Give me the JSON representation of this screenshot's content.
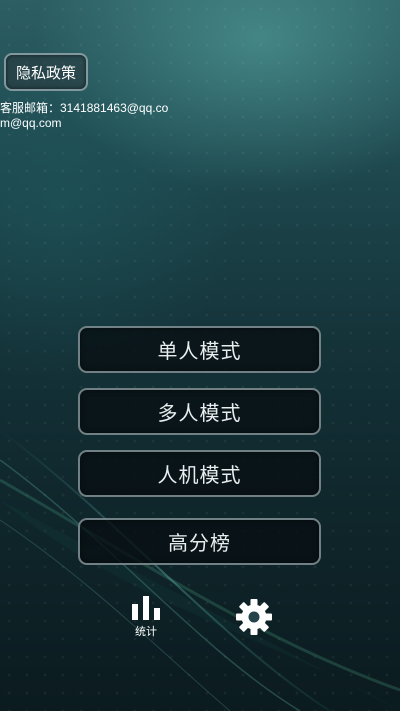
{
  "header": {
    "privacy_label": "隐私政策",
    "contact_text": "客服邮箱：3141881463@qq.com@qq.com"
  },
  "menu": {
    "single_label": "单人模式",
    "multi_label": "多人模式",
    "ai_label": "人机模式",
    "rank_label": "高分榜"
  },
  "bottom": {
    "stats_label": "统计",
    "settings_icon": "gear-icon",
    "stats_icon": "bar-chart-icon"
  },
  "colors": {
    "background_top": "#2c5e63",
    "background_bottom": "#0b1b1f",
    "button_fill": "#0e161a",
    "button_border": "#96a5aa",
    "icon": "#ffffff"
  }
}
